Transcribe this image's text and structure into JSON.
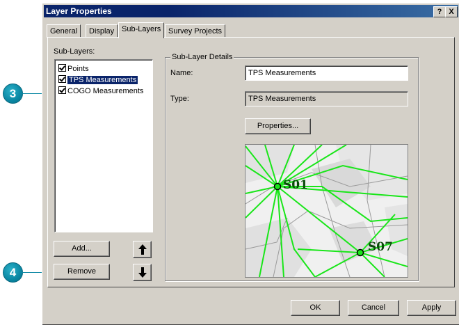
{
  "window": {
    "title": "Layer Properties",
    "help_btn": "?",
    "close_btn": "X"
  },
  "tabs": [
    {
      "label": "General",
      "active": false
    },
    {
      "label": "Display",
      "active": false
    },
    {
      "label": "Sub-Layers",
      "active": true
    },
    {
      "label": "Survey Projects",
      "active": false
    }
  ],
  "sublayers": {
    "label": "Sub-Layers:",
    "items": [
      {
        "label": "Points",
        "checked": true,
        "selected": false
      },
      {
        "label": "TPS Measurements",
        "checked": true,
        "selected": true
      },
      {
        "label": "COGO Measurements",
        "checked": true,
        "selected": false
      }
    ],
    "add_label": "Add...",
    "remove_label": "Remove",
    "up_icon": "arrow-up-icon",
    "down_icon": "arrow-down-icon"
  },
  "details": {
    "group_label": "Sub-Layer Details",
    "name_label": "Name:",
    "name_value": "TPS Measurements",
    "type_label": "Type:",
    "type_value": "TPS Measurements",
    "properties_label": "Properties...",
    "preview": {
      "station_a": "S01",
      "station_b": "S07",
      "line_color": "#19e619"
    }
  },
  "footer": {
    "ok_label": "OK",
    "cancel_label": "Cancel",
    "apply_label": "Apply"
  },
  "callouts": [
    {
      "number": "3"
    },
    {
      "number": "4"
    }
  ]
}
